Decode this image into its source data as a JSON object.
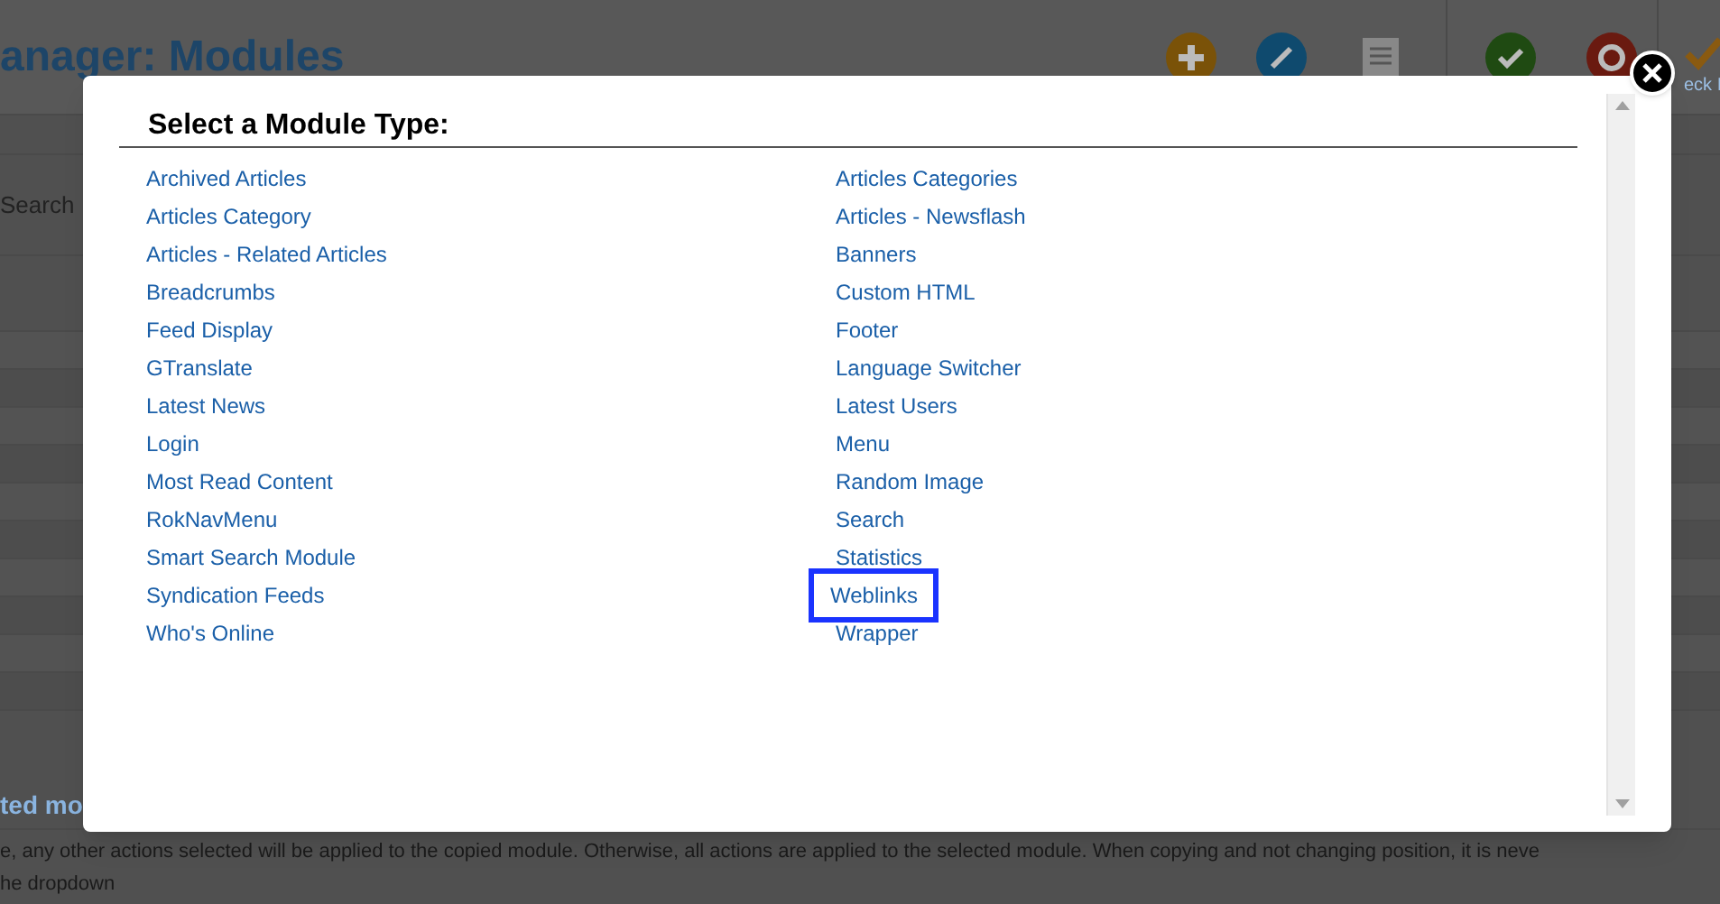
{
  "background_page": {
    "title": "anager: Modules",
    "toolbar_label": "eck I",
    "search_label": "Search",
    "section_heading": "ted mo",
    "note_lines": [
      "e, any other actions selected will be applied to the copied module. Otherwise, all actions are applied to the selected module. When copying and not changing position, it is neve",
      "he dropdown"
    ]
  },
  "modal": {
    "title": "Select a Module Type:",
    "columns": [
      [
        {
          "label": "Archived Articles",
          "highlighted": false
        },
        {
          "label": "Articles Category",
          "highlighted": false
        },
        {
          "label": "Articles - Related Articles",
          "highlighted": false
        },
        {
          "label": "Breadcrumbs",
          "highlighted": false
        },
        {
          "label": "Feed Display",
          "highlighted": false
        },
        {
          "label": "GTranslate",
          "highlighted": false
        },
        {
          "label": "Latest News",
          "highlighted": false
        },
        {
          "label": "Login",
          "highlighted": false
        },
        {
          "label": "Most Read Content",
          "highlighted": false
        },
        {
          "label": "RokNavMenu",
          "highlighted": false
        },
        {
          "label": "Smart Search Module",
          "highlighted": false
        },
        {
          "label": "Syndication Feeds",
          "highlighted": false
        },
        {
          "label": "Who's Online",
          "highlighted": false
        }
      ],
      [
        {
          "label": "Articles Categories",
          "highlighted": false
        },
        {
          "label": "Articles - Newsflash",
          "highlighted": false
        },
        {
          "label": "Banners",
          "highlighted": false
        },
        {
          "label": "Custom HTML",
          "highlighted": false
        },
        {
          "label": "Footer",
          "highlighted": false
        },
        {
          "label": "Language Switcher",
          "highlighted": false
        },
        {
          "label": "Latest Users",
          "highlighted": false
        },
        {
          "label": "Menu",
          "highlighted": false
        },
        {
          "label": "Random Image",
          "highlighted": false
        },
        {
          "label": "Search",
          "highlighted": false
        },
        {
          "label": "Statistics",
          "highlighted": false
        },
        {
          "label": "Weblinks",
          "highlighted": true
        },
        {
          "label": "Wrapper",
          "highlighted": false
        }
      ]
    ]
  }
}
